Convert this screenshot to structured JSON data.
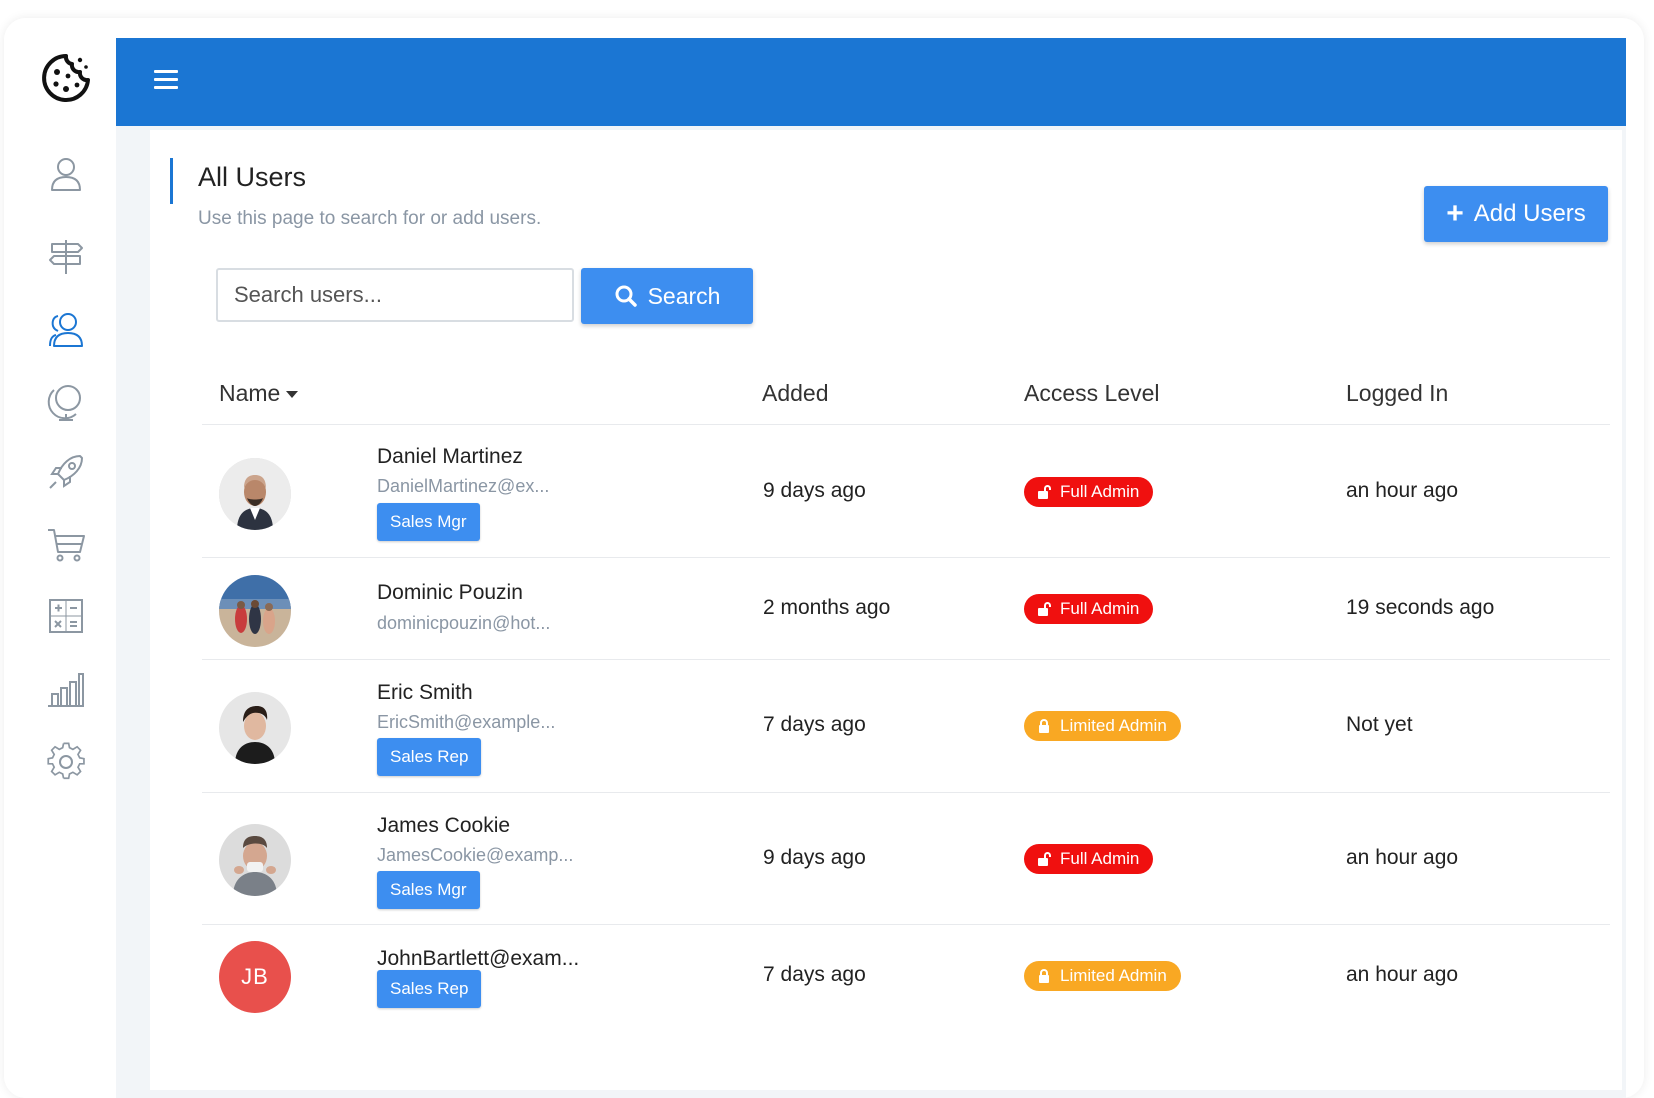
{
  "header": {
    "title": "All Users",
    "subtitle": "Use this page to search for or add users.",
    "add_label": "Add Users"
  },
  "search": {
    "placeholder": "Search users...",
    "button_label": "Search"
  },
  "columns": {
    "name": "Name",
    "added": "Added",
    "access": "Access Level",
    "logged": "Logged In"
  },
  "users": [
    {
      "name": "Daniel Martinez",
      "email": "DanielMartinez@ex...",
      "role": "Sales Mgr",
      "added": "9 days ago",
      "access": "Full Admin",
      "logged": "an hour ago"
    },
    {
      "name": "Dominic Pouzin",
      "email": "dominicpouzin@hot...",
      "role": "",
      "added": "2 months ago",
      "access": "Full Admin",
      "logged": "19 seconds ago"
    },
    {
      "name": "Eric Smith",
      "email": "EricSmith@example...",
      "role": "Sales Rep",
      "added": "7 days ago",
      "access": "Limited Admin",
      "logged": "Not yet"
    },
    {
      "name": "James Cookie",
      "email": "JamesCookie@examp...",
      "role": "Sales Mgr",
      "added": "9 days ago",
      "access": "Full Admin",
      "logged": "an hour ago"
    },
    {
      "name": "JohnBartlett@exam...",
      "initials": "JB",
      "role": "Sales Rep",
      "added": "7 days ago",
      "access": "Limited Admin",
      "logged": "an hour ago"
    }
  ],
  "colors": {
    "topbar": "#1b76d3",
    "primary_button": "#3d8ef0",
    "full_admin": "#f0100f",
    "limited_admin": "#f9a823",
    "initials_avatar": "#e8504c"
  },
  "sidebar_icons": [
    "user-icon",
    "signpost-icon",
    "users-icon",
    "globe-icon",
    "rocket-icon",
    "cart-icon",
    "calculator-icon",
    "bar-chart-icon",
    "gear-icon"
  ]
}
